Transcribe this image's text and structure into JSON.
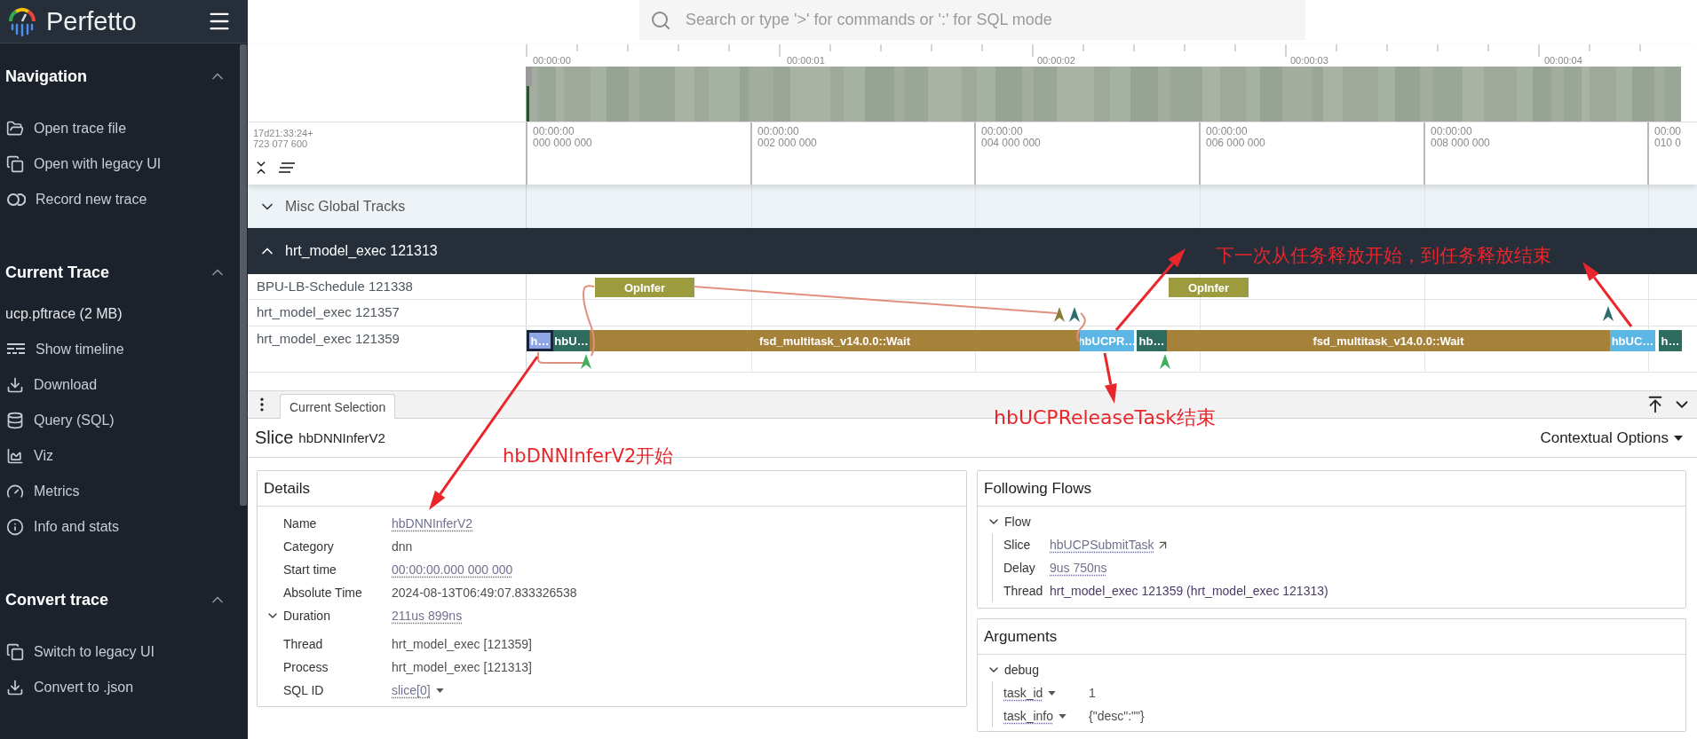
{
  "app": {
    "title": "Perfetto"
  },
  "search": {
    "placeholder": "Search or type '>' for commands or ':' for SQL mode"
  },
  "sidebar": {
    "sections": [
      {
        "title": "Navigation",
        "expanded": true,
        "items": [
          "Open trace file",
          "Open with legacy UI",
          "Record new trace"
        ]
      },
      {
        "title": "Current Trace",
        "expanded": true,
        "trace_file": "ucp.pftrace (2 MB)",
        "items": [
          "Show timeline",
          "Download",
          "Query (SQL)",
          "Viz",
          "Metrics",
          "Info and stats"
        ]
      },
      {
        "title": "Convert trace",
        "expanded": true,
        "items": [
          "Switch to legacy UI",
          "Convert to .json"
        ]
      }
    ]
  },
  "overview": {
    "ticks": [
      "00:00:00",
      "00:00:01",
      "00:00:02",
      "00:00:03",
      "00:00:04"
    ]
  },
  "time_axis": {
    "offset_date": "17d21:33:24+",
    "offset_ns": "723 077 600",
    "ticks": [
      {
        "time": "00:00:00",
        "ns": "000 000 000"
      },
      {
        "time": "00:00:00",
        "ns": "002 000 000"
      },
      {
        "time": "00:00:00",
        "ns": "004 000 000"
      },
      {
        "time": "00:00:00",
        "ns": "006 000 000"
      },
      {
        "time": "00:00:00",
        "ns": "008 000 000"
      },
      {
        "time": "00:00",
        "ns": "010 0"
      }
    ]
  },
  "tracks": {
    "global": {
      "title": "Misc Global Tracks",
      "expanded": false
    },
    "group": {
      "title": "hrt_model_exec 121313",
      "expanded": true,
      "threads": [
        {
          "name": "BPU-LB-Schedule 121338",
          "slices": [
            {
              "label": "OpInfer",
              "color": "#9c9c3e",
              "selected": false
            },
            {
              "label": "OpInfer",
              "color": "#9c9c3e",
              "selected": false
            }
          ]
        },
        {
          "name": "hrt_model_exec 121357"
        },
        {
          "name": "hrt_model_exec 121359",
          "slices": [
            {
              "label": "h…",
              "color": "#8fa6e6",
              "selected": true
            },
            {
              "label": "hbU…",
              "color": "#2e6b5f",
              "selected": false
            },
            {
              "label": "fsd_multitask_v14.0.0::Wait",
              "color": "#a6813a",
              "selected": false
            },
            {
              "label": "hbUCPR…",
              "color": "#5cb6e6",
              "selected": false
            },
            {
              "label": "hb…",
              "color": "#2e6b5f",
              "selected": false
            },
            {
              "label": "fsd_multitask_v14.0.0::Wait",
              "color": "#a6813a",
              "selected": false
            },
            {
              "label": "hbUC…",
              "color": "#5cb6e6",
              "selected": false
            },
            {
              "label": "h…",
              "color": "#2e6b5f",
              "selected": false
            }
          ]
        }
      ]
    }
  },
  "panel": {
    "tabs": [
      {
        "label": "Current Selection",
        "selected": true
      }
    ],
    "selection": {
      "kind": "Slice",
      "name": "hbDNNInferV2",
      "options": "Contextual Options"
    },
    "details": {
      "title": "Details",
      "rows": [
        {
          "label": "Name",
          "value": "hbDNNInferV2",
          "kind": "link"
        },
        {
          "label": "Category",
          "value": "dnn",
          "kind": "text"
        },
        {
          "label": "Start time",
          "value": "00:00:00.000 000 000",
          "kind": "link"
        },
        {
          "label": "Absolute Time",
          "value": "2024-08-13T06:49:07.833326538",
          "kind": "text"
        },
        {
          "label": "Duration",
          "value": "211us 899ns",
          "kind": "group",
          "expanded": true
        },
        {
          "label": "Thread",
          "value": "hrt_model_exec [121359]",
          "kind": "text"
        },
        {
          "label": "Process",
          "value": "hrt_model_exec [121313]",
          "kind": "text"
        },
        {
          "label": "SQL ID",
          "value": "slice[0]",
          "kind": "menu"
        }
      ]
    },
    "flows": {
      "title": "Following Flows",
      "group": {
        "label": "Flow",
        "expanded": true,
        "rows": [
          {
            "label": "Slice",
            "value": "hbUCPSubmitTask",
            "kind": "jump"
          },
          {
            "label": "Delay",
            "value": "9us 750ns",
            "kind": "link"
          },
          {
            "label": "Thread",
            "value": "hrt_model_exec 121359 (hrt_model_exec 121313)",
            "kind": "thread"
          }
        ]
      }
    },
    "arguments": {
      "title": "Arguments",
      "group": {
        "label": "debug",
        "expanded": true,
        "rows": [
          {
            "key": "task_id",
            "value": "1"
          },
          {
            "key": "task_info",
            "value": "{\"desc\":\"\"}"
          }
        ]
      }
    }
  },
  "annotations": [
    {
      "text": "下一次从任务释放开始，到任务释放结束"
    },
    {
      "text": "hbUCPReleaseTask结束"
    },
    {
      "text": "hbDNNInferV2开始"
    }
  ]
}
